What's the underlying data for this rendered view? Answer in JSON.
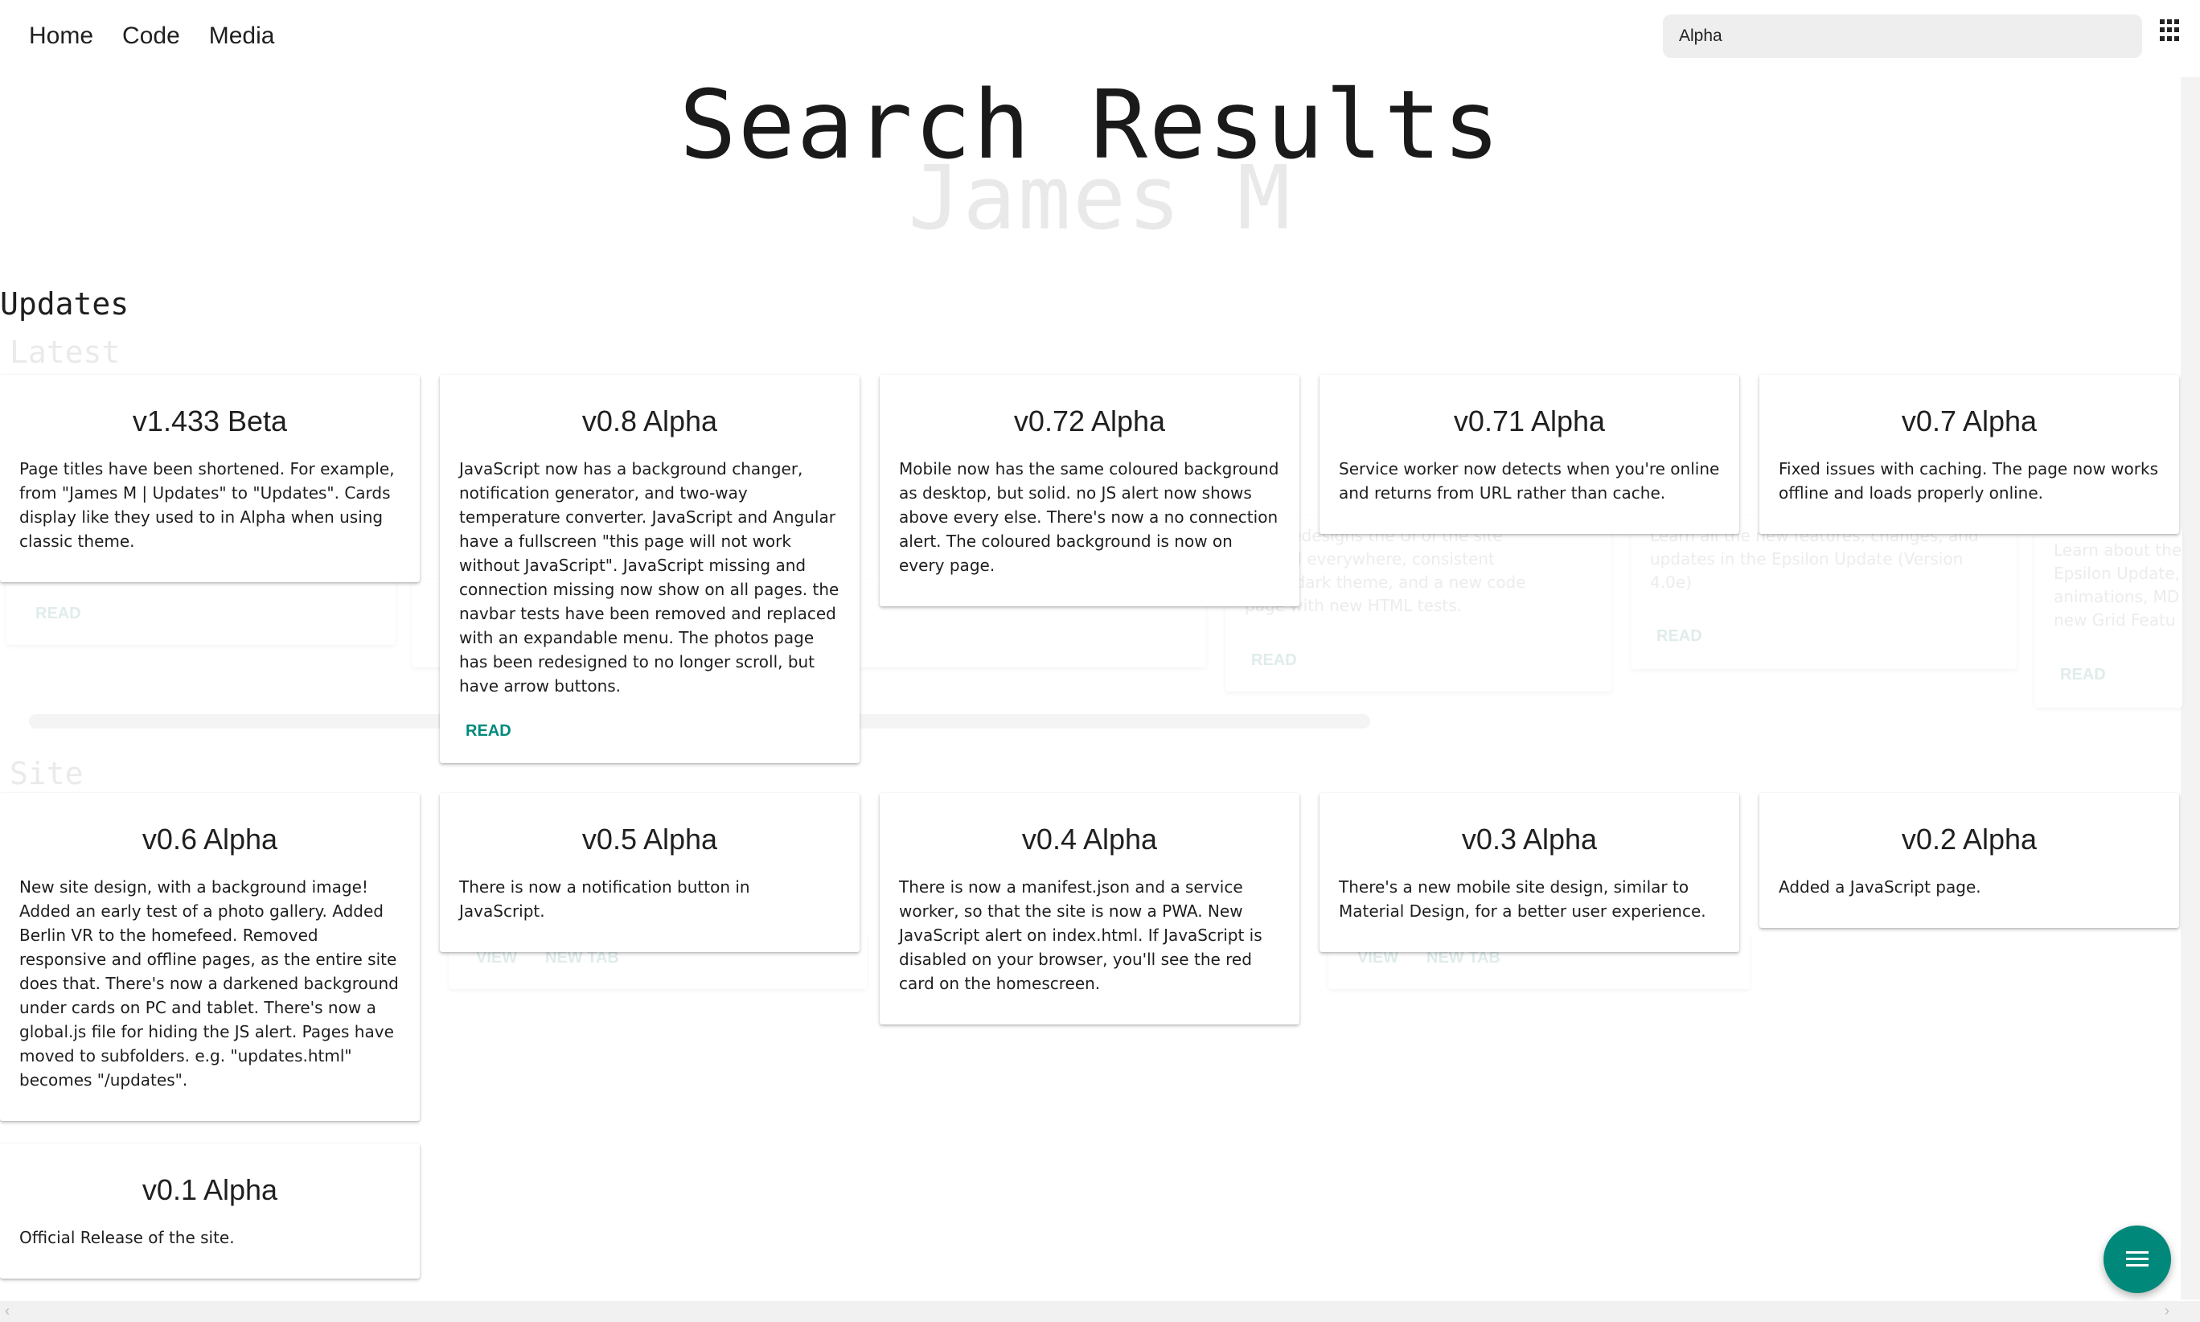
{
  "nav": {
    "links": [
      "Home",
      "Code",
      "Media"
    ],
    "search_value": "Alpha"
  },
  "hero": {
    "title": "Search Results",
    "subtitle": "James M"
  },
  "sections": {
    "updates_heading": "Updates",
    "latest_heading": "Latest",
    "site_heading": "Site"
  },
  "background_faded": {
    "text_1": "4.0e redesigns the UI of the site",
    "text_2": "SS grid everywhere, consistent",
    "text_3": "and a dark theme, and a new code",
    "text_4": "page with new HTML tests.",
    "text_5": "Learn all the new features, changes, and",
    "text_6": "updates in the Epsilon Update (Version",
    "text_7": "4.0e)",
    "text_8": "Learn about the",
    "text_9": "Epsilon Update,",
    "text_10": "animations, MD",
    "text_11": "new Grid Featu",
    "read": "READ",
    "view": "VIEW",
    "new_tab": "NEW TAB"
  },
  "cards": [
    {
      "title": "v1.433 Beta",
      "body": "Page titles have been shortened. For example, from \"James M | Updates\" to \"Updates\". Cards display like they used to in Alpha when using classic theme."
    },
    {
      "title": "v0.8 Alpha",
      "body": "JavaScript now has a background changer, notification generator, and two-way temperature converter. JavaScript and Angular have a fullscreen \"this page will not work without JavaScript\". JavaScript missing and connection missing now show on all pages. the navbar tests have been removed and replaced with an expandable menu. The photos page has been redesigned to no longer scroll, but have arrow buttons.",
      "action": "READ"
    },
    {
      "title": "v0.72 Alpha",
      "body": "Mobile now has the same coloured background as desktop, but solid. no JS alert now shows above every else. There's now a no connection alert. The coloured background is now on every page."
    },
    {
      "title": "v0.71 Alpha",
      "body": "Service worker now detects when you're online and returns from URL rather than cache."
    },
    {
      "title": "v0.7 Alpha",
      "body": "Fixed issues with caching. The page now works offline and loads properly online."
    },
    {
      "title": "v0.6 Alpha",
      "body": "New site design, with a background image! Added an early test of a photo gallery. Added Berlin VR to the homefeed. Removed responsive and offline pages, as the entire site does that. There's now a darkened background under cards on PC and tablet. There's now a global.js file for hiding the JS alert. Pages have moved to subfolders. e.g. \"updates.html\" becomes \"/updates\"."
    },
    {
      "title": "v0.5 Alpha",
      "body": "There is now a notification button in JavaScript."
    },
    {
      "title": "v0.4 Alpha",
      "body": "There is now a manifest.json and a service worker, so that the site is now a PWA. New JavaScript alert on index.html. If JavaScript is disabled on your browser, you'll see the red card on the homescreen."
    },
    {
      "title": "v0.3 Alpha",
      "body": "There's a new mobile site design, similar to Material Design, for a better user experience."
    },
    {
      "title": "v0.2 Alpha",
      "body": "Added a JavaScript page."
    },
    {
      "title": "v0.1 Alpha",
      "body": "Official Release of the site."
    }
  ]
}
